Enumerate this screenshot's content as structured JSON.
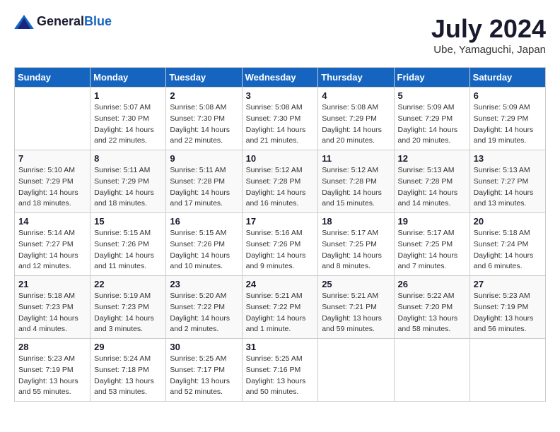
{
  "header": {
    "logo_general": "General",
    "logo_blue": "Blue",
    "month_year": "July 2024",
    "location": "Ube, Yamaguchi, Japan"
  },
  "weekdays": [
    "Sunday",
    "Monday",
    "Tuesday",
    "Wednesday",
    "Thursday",
    "Friday",
    "Saturday"
  ],
  "weeks": [
    [
      {
        "day": "",
        "info": ""
      },
      {
        "day": "1",
        "info": "Sunrise: 5:07 AM\nSunset: 7:30 PM\nDaylight: 14 hours\nand 22 minutes."
      },
      {
        "day": "2",
        "info": "Sunrise: 5:08 AM\nSunset: 7:30 PM\nDaylight: 14 hours\nand 22 minutes."
      },
      {
        "day": "3",
        "info": "Sunrise: 5:08 AM\nSunset: 7:30 PM\nDaylight: 14 hours\nand 21 minutes."
      },
      {
        "day": "4",
        "info": "Sunrise: 5:08 AM\nSunset: 7:29 PM\nDaylight: 14 hours\nand 20 minutes."
      },
      {
        "day": "5",
        "info": "Sunrise: 5:09 AM\nSunset: 7:29 PM\nDaylight: 14 hours\nand 20 minutes."
      },
      {
        "day": "6",
        "info": "Sunrise: 5:09 AM\nSunset: 7:29 PM\nDaylight: 14 hours\nand 19 minutes."
      }
    ],
    [
      {
        "day": "7",
        "info": "Sunrise: 5:10 AM\nSunset: 7:29 PM\nDaylight: 14 hours\nand 18 minutes."
      },
      {
        "day": "8",
        "info": "Sunrise: 5:11 AM\nSunset: 7:29 PM\nDaylight: 14 hours\nand 18 minutes."
      },
      {
        "day": "9",
        "info": "Sunrise: 5:11 AM\nSunset: 7:28 PM\nDaylight: 14 hours\nand 17 minutes."
      },
      {
        "day": "10",
        "info": "Sunrise: 5:12 AM\nSunset: 7:28 PM\nDaylight: 14 hours\nand 16 minutes."
      },
      {
        "day": "11",
        "info": "Sunrise: 5:12 AM\nSunset: 7:28 PM\nDaylight: 14 hours\nand 15 minutes."
      },
      {
        "day": "12",
        "info": "Sunrise: 5:13 AM\nSunset: 7:28 PM\nDaylight: 14 hours\nand 14 minutes."
      },
      {
        "day": "13",
        "info": "Sunrise: 5:13 AM\nSunset: 7:27 PM\nDaylight: 14 hours\nand 13 minutes."
      }
    ],
    [
      {
        "day": "14",
        "info": "Sunrise: 5:14 AM\nSunset: 7:27 PM\nDaylight: 14 hours\nand 12 minutes."
      },
      {
        "day": "15",
        "info": "Sunrise: 5:15 AM\nSunset: 7:26 PM\nDaylight: 14 hours\nand 11 minutes."
      },
      {
        "day": "16",
        "info": "Sunrise: 5:15 AM\nSunset: 7:26 PM\nDaylight: 14 hours\nand 10 minutes."
      },
      {
        "day": "17",
        "info": "Sunrise: 5:16 AM\nSunset: 7:26 PM\nDaylight: 14 hours\nand 9 minutes."
      },
      {
        "day": "18",
        "info": "Sunrise: 5:17 AM\nSunset: 7:25 PM\nDaylight: 14 hours\nand 8 minutes."
      },
      {
        "day": "19",
        "info": "Sunrise: 5:17 AM\nSunset: 7:25 PM\nDaylight: 14 hours\nand 7 minutes."
      },
      {
        "day": "20",
        "info": "Sunrise: 5:18 AM\nSunset: 7:24 PM\nDaylight: 14 hours\nand 6 minutes."
      }
    ],
    [
      {
        "day": "21",
        "info": "Sunrise: 5:18 AM\nSunset: 7:23 PM\nDaylight: 14 hours\nand 4 minutes."
      },
      {
        "day": "22",
        "info": "Sunrise: 5:19 AM\nSunset: 7:23 PM\nDaylight: 14 hours\nand 3 minutes."
      },
      {
        "day": "23",
        "info": "Sunrise: 5:20 AM\nSunset: 7:22 PM\nDaylight: 14 hours\nand 2 minutes."
      },
      {
        "day": "24",
        "info": "Sunrise: 5:21 AM\nSunset: 7:22 PM\nDaylight: 14 hours\nand 1 minute."
      },
      {
        "day": "25",
        "info": "Sunrise: 5:21 AM\nSunset: 7:21 PM\nDaylight: 13 hours\nand 59 minutes."
      },
      {
        "day": "26",
        "info": "Sunrise: 5:22 AM\nSunset: 7:20 PM\nDaylight: 13 hours\nand 58 minutes."
      },
      {
        "day": "27",
        "info": "Sunrise: 5:23 AM\nSunset: 7:19 PM\nDaylight: 13 hours\nand 56 minutes."
      }
    ],
    [
      {
        "day": "28",
        "info": "Sunrise: 5:23 AM\nSunset: 7:19 PM\nDaylight: 13 hours\nand 55 minutes."
      },
      {
        "day": "29",
        "info": "Sunrise: 5:24 AM\nSunset: 7:18 PM\nDaylight: 13 hours\nand 53 minutes."
      },
      {
        "day": "30",
        "info": "Sunrise: 5:25 AM\nSunset: 7:17 PM\nDaylight: 13 hours\nand 52 minutes."
      },
      {
        "day": "31",
        "info": "Sunrise: 5:25 AM\nSunset: 7:16 PM\nDaylight: 13 hours\nand 50 minutes."
      },
      {
        "day": "",
        "info": ""
      },
      {
        "day": "",
        "info": ""
      },
      {
        "day": "",
        "info": ""
      }
    ]
  ]
}
